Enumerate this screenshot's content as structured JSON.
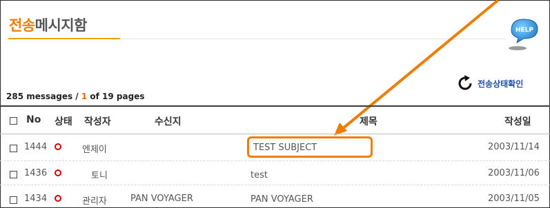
{
  "title": {
    "highlight": "전송",
    "rest": "메시지함"
  },
  "help": {
    "label": "HELP"
  },
  "summary": {
    "count": "285 messages / ",
    "current_page": "1",
    "suffix": " of 19 pages"
  },
  "status_button": {
    "label": "전송상태확인"
  },
  "table": {
    "headers": {
      "no": "No",
      "status": "상태",
      "author": "작성자",
      "recipient": "수신지",
      "subject": "제목",
      "date": "작성일"
    },
    "rows": [
      {
        "no": "1444",
        "author": "엔제이",
        "recipient": "",
        "subject": "TEST SUBJECT",
        "date": "2003/11/14"
      },
      {
        "no": "1436",
        "author": "토니",
        "recipient": "",
        "subject": "test",
        "date": "2003/11/06"
      },
      {
        "no": "1434",
        "author": "관리자",
        "recipient": "PAN VOYAGER",
        "subject": "PAN VOYAGER",
        "date": "2003/11/05"
      }
    ]
  },
  "colors": {
    "accent": "#f07d00",
    "status": "#d40000",
    "link": "#1d4fb3"
  }
}
